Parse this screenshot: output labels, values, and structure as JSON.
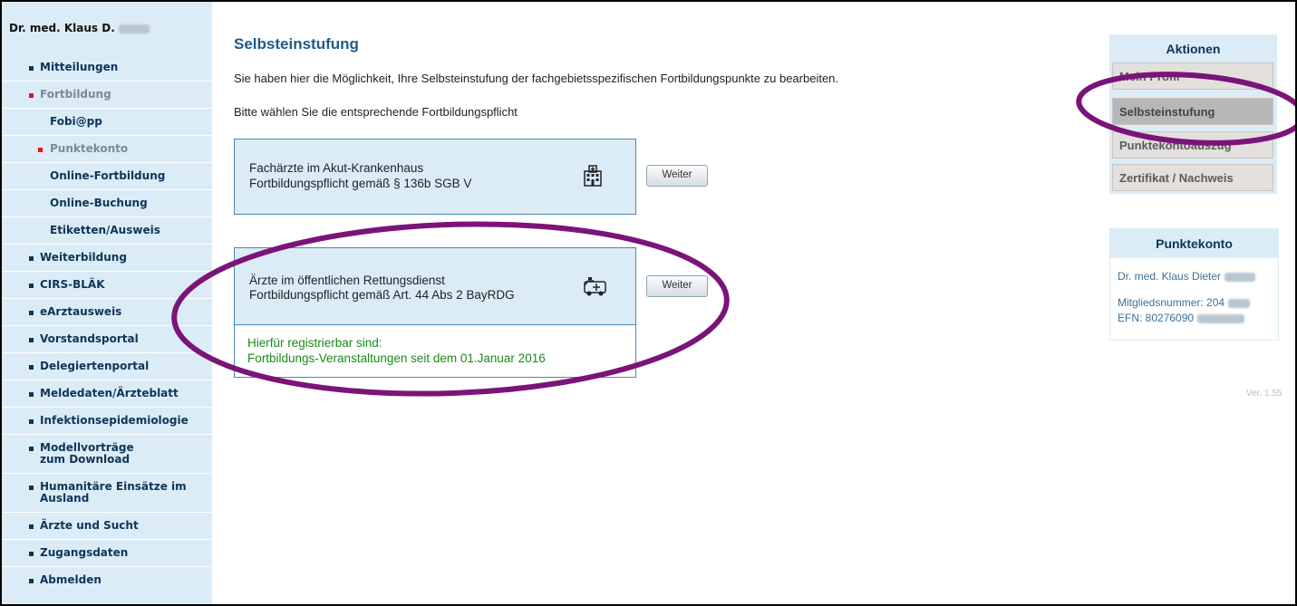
{
  "sidebar": {
    "user_name": "Dr. med. Klaus D.",
    "items": [
      {
        "label": "Mitteilungen"
      },
      {
        "label": "Fortbildung"
      },
      {
        "label": "Fobi@pp"
      },
      {
        "label": "Punktekonto"
      },
      {
        "label": "Online-Fortbildung"
      },
      {
        "label": "Online-Buchung"
      },
      {
        "label": "Etiketten/Ausweis"
      },
      {
        "label": "Weiterbildung"
      },
      {
        "label": "CIRS-BLÄK"
      },
      {
        "label": "eArztausweis"
      },
      {
        "label": "Vorstandsportal"
      },
      {
        "label": "Delegiertenportal"
      },
      {
        "label": "Meldedaten/Ärzteblatt"
      },
      {
        "label": "Infektionsepidemiologie"
      },
      {
        "label": "Modellvorträge\nzum Download"
      },
      {
        "label": "Humanitäre Einsätze im\nAusland"
      },
      {
        "label": "Ärzte und Sucht"
      },
      {
        "label": "Zugangsdaten"
      },
      {
        "label": "Abmelden"
      }
    ]
  },
  "main": {
    "title": "Selbsteinstufung",
    "intro": "Sie haben hier die Möglichkeit, Ihre Selbsteinstufung der fachgebietsspezifischen Fortbildungspunkte zu bearbeiten.",
    "choose": "Bitte wählen Sie die entsprechende Fortbildungspflicht",
    "option1": {
      "line1": "Fachärzte im Akut-Krankenhaus",
      "line2": "Fortbildungspflicht gemäß § 136b SGB V",
      "icon": "hospital-icon",
      "button": "Weiter"
    },
    "option2": {
      "line1": "Ärzte im öffentlichen Rettungsdienst",
      "line2": "Fortbildungspflicht gemäß Art. 44 Abs 2 BayRDG",
      "icon": "ambulance-icon",
      "button": "Weiter",
      "note1": "Hierfür registrierbar sind:",
      "note2": "Fortbildungs-Veranstaltungen seit dem 01.Januar 2016"
    }
  },
  "actions": {
    "title": "Aktionen",
    "items": [
      {
        "label": "Mein Profil"
      },
      {
        "label": "Selbsteinstufung"
      },
      {
        "label": "Punktekontoauszug"
      },
      {
        "label": "Zertifikat / Nachweis"
      }
    ]
  },
  "punktekonto": {
    "title": "Punktekonto",
    "name": "Dr. med. Klaus Dieter",
    "member": "Mitgliedsnummer: 204",
    "efn": "EFN: 80276090"
  },
  "version": "Ver. 1.55",
  "colors": {
    "sidebar_bg": "#dcecf7",
    "link": "#0e3558",
    "title": "#1d5a86",
    "note_green": "#1a8a1a",
    "annotation": "#7b1479"
  }
}
